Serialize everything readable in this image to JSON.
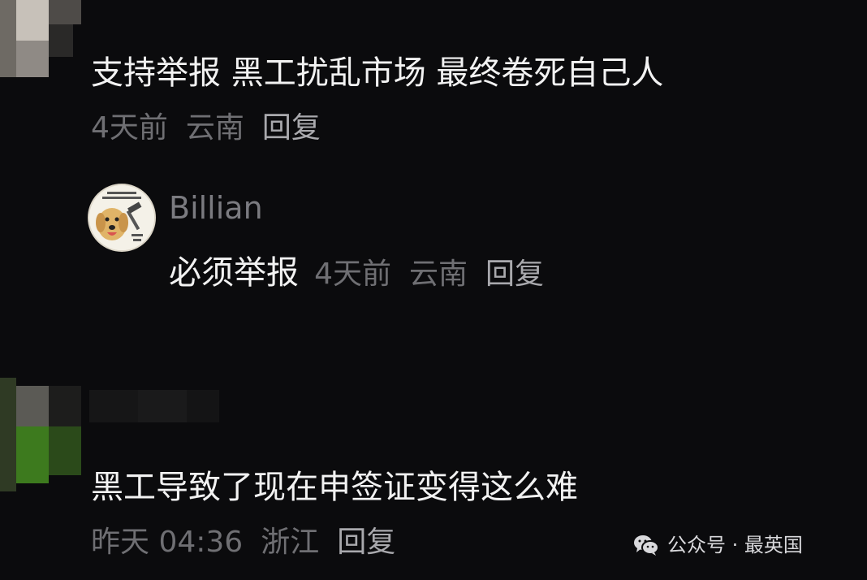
{
  "comments": [
    {
      "text": "支持举报 黑工扰乱市场 最终卷死自己人",
      "time": "4天前",
      "location": "云南",
      "reply": "回复"
    },
    {
      "username": "Billian",
      "text": "必须举报",
      "time": "4天前",
      "location": "云南",
      "reply": "回复"
    },
    {
      "text": "黑工导致了现在申签证变得这么难",
      "time": "昨天 04:36",
      "location": "浙江",
      "reply": "回复"
    }
  ],
  "watermark": {
    "text": "公众号 · 最英国",
    "icon": "wechat-icon"
  },
  "colors": {
    "background": "#0b0b0d",
    "comment_text": "#f2f2f2",
    "meta_text": "#6f6f73",
    "reply_text": "#a9a9ad"
  }
}
